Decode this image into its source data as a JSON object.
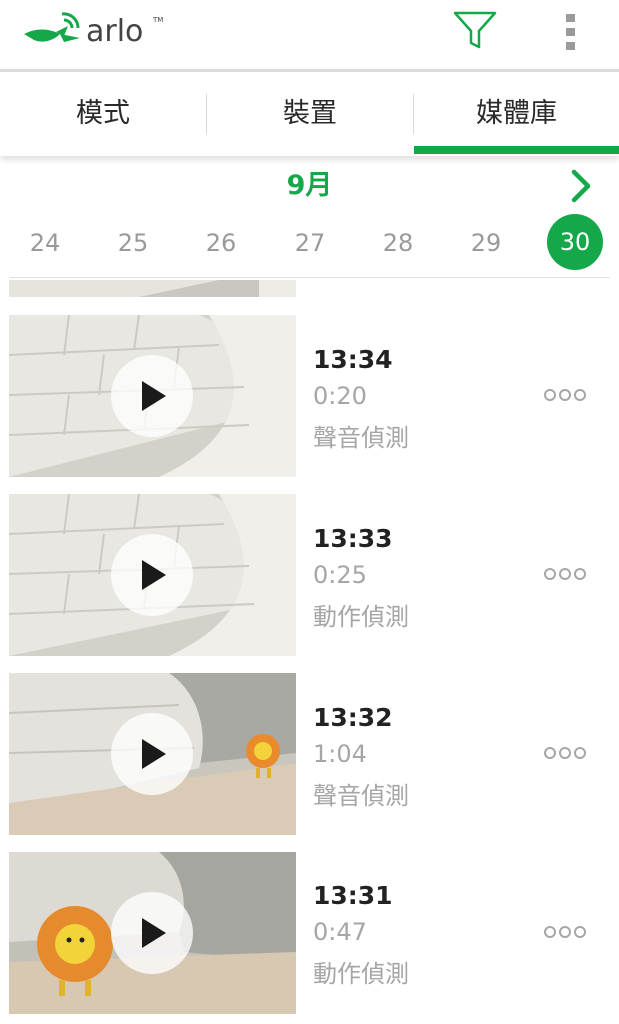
{
  "header": {
    "logo_text": "arlo",
    "logo_tm": "TM",
    "filter_icon": "filter-icon",
    "more_icon": "more-vertical-icon"
  },
  "tabs": [
    {
      "label": "模式",
      "active": false
    },
    {
      "label": "裝置",
      "active": false
    },
    {
      "label": "媒體庫",
      "active": true
    }
  ],
  "calendar": {
    "month": "9月",
    "days": [
      "24",
      "25",
      "26",
      "27",
      "28",
      "29",
      "30"
    ],
    "selected_day": "30"
  },
  "clips": [
    {
      "time": "13:34",
      "duration": "0:20",
      "type": "聲音偵測"
    },
    {
      "time": "13:33",
      "duration": "0:25",
      "type": "動作偵測"
    },
    {
      "time": "13:32",
      "duration": "1:04",
      "type": "聲音偵測"
    },
    {
      "time": "13:31",
      "duration": "0:47",
      "type": "動作偵測"
    }
  ],
  "colors": {
    "accent": "#14a84a",
    "text_primary": "#222222",
    "text_secondary": "#a6a6a6"
  }
}
